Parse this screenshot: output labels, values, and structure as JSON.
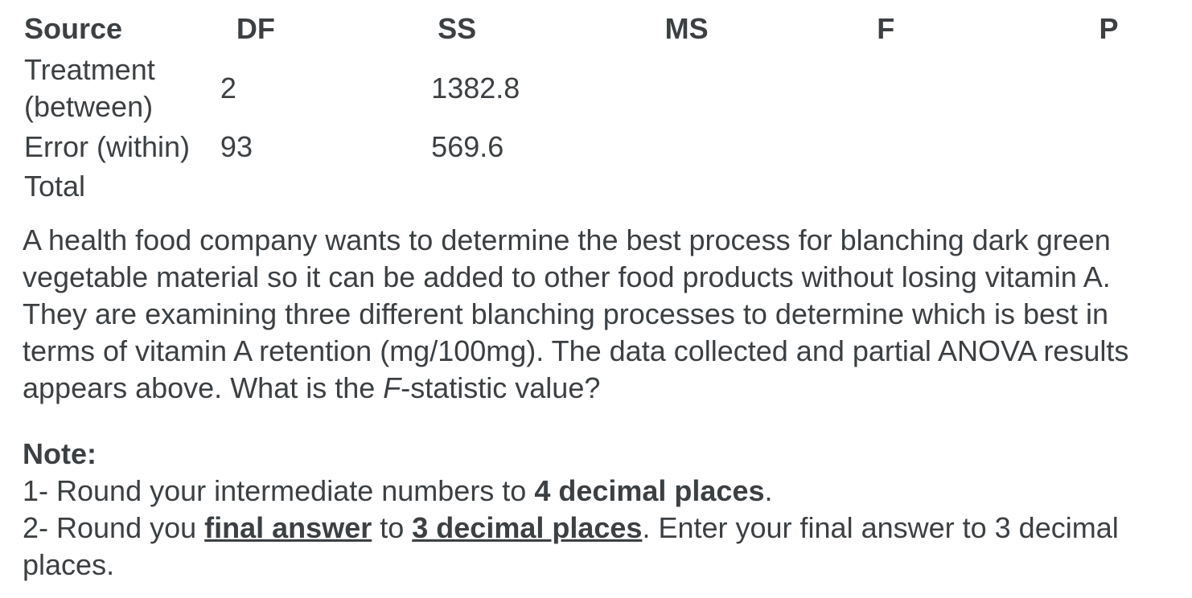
{
  "anova_table": {
    "headers": [
      "Source",
      "DF",
      "SS",
      "MS",
      "F",
      "P"
    ],
    "rows": [
      {
        "source_line1": "Treatment",
        "source_line2": "(between)",
        "df": "2",
        "ss": "1382.8",
        "ms": "",
        "f": "",
        "p": ""
      },
      {
        "source": "Error (within)",
        "df": "93",
        "ss": "569.6",
        "ms": "",
        "f": "",
        "p": ""
      },
      {
        "source": "Total",
        "df": "",
        "ss": "",
        "ms": "",
        "f": "",
        "p": ""
      }
    ]
  },
  "question": {
    "text_before_italic": "A health food company wants to determine the best process for blanching dark green vegetable material so it can be added to other food products without losing vitamin A. They are examining three different blanching processes to determine which is best in terms of vitamin A retention (mg/100mg). The data collected and partial ANOVA results appears above. What is the ",
    "italic": "F",
    "text_after_italic": "-statistic value?"
  },
  "note": {
    "title": "Note:",
    "line1_prefix": "1- Round your intermediate numbers to ",
    "line1_bold": "4 decimal places",
    "line1_suffix": ".",
    "line2_prefix": "2- Round you ",
    "line2_underline1": "final answer",
    "line2_mid": " to ",
    "line2_underline2": "3 decimal places",
    "line2_suffix": ". Enter your final answer to 3 decimal places."
  }
}
